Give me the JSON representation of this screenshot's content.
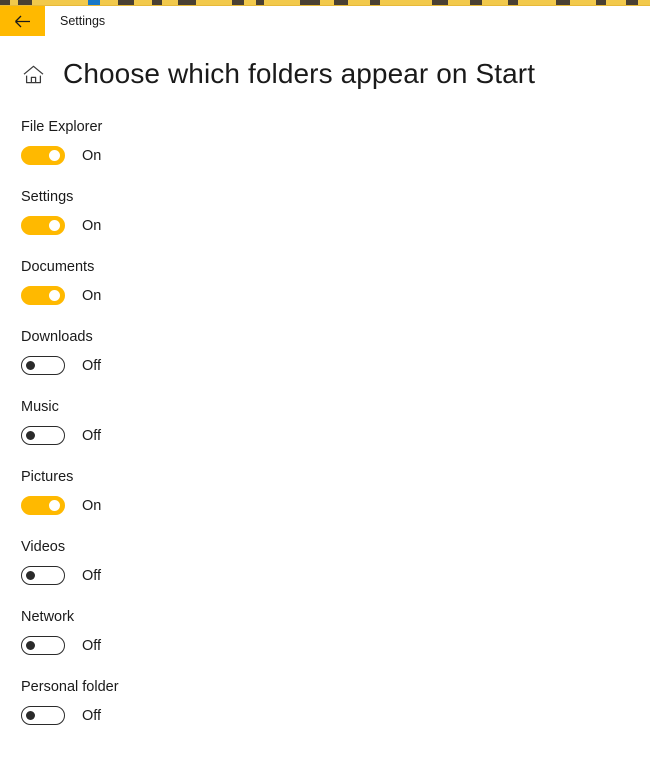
{
  "window": {
    "titlebar": {
      "app_title": "Settings",
      "back_icon": "arrow-left-icon",
      "back_accent_color": "#ffb900"
    },
    "background_sliver": {
      "color": "#f2c94c",
      "accent_color": "#1878c8"
    }
  },
  "header": {
    "home_icon": "home-icon",
    "title": "Choose which folders appear on Start"
  },
  "colors": {
    "accent_on": "#ffb900",
    "toggle_off_border": "#2b2b2b",
    "text": "#1a1a1a",
    "page_background": "#ffffff"
  },
  "folders": [
    {
      "label": "File Explorer",
      "state": "On",
      "on": true
    },
    {
      "label": "Settings",
      "state": "On",
      "on": true
    },
    {
      "label": "Documents",
      "state": "On",
      "on": true
    },
    {
      "label": "Downloads",
      "state": "Off",
      "on": false
    },
    {
      "label": "Music",
      "state": "Off",
      "on": false
    },
    {
      "label": "Pictures",
      "state": "On",
      "on": true
    },
    {
      "label": "Videos",
      "state": "Off",
      "on": false
    },
    {
      "label": "Network",
      "state": "Off",
      "on": false
    },
    {
      "label": "Personal folder",
      "state": "Off",
      "on": false
    }
  ]
}
